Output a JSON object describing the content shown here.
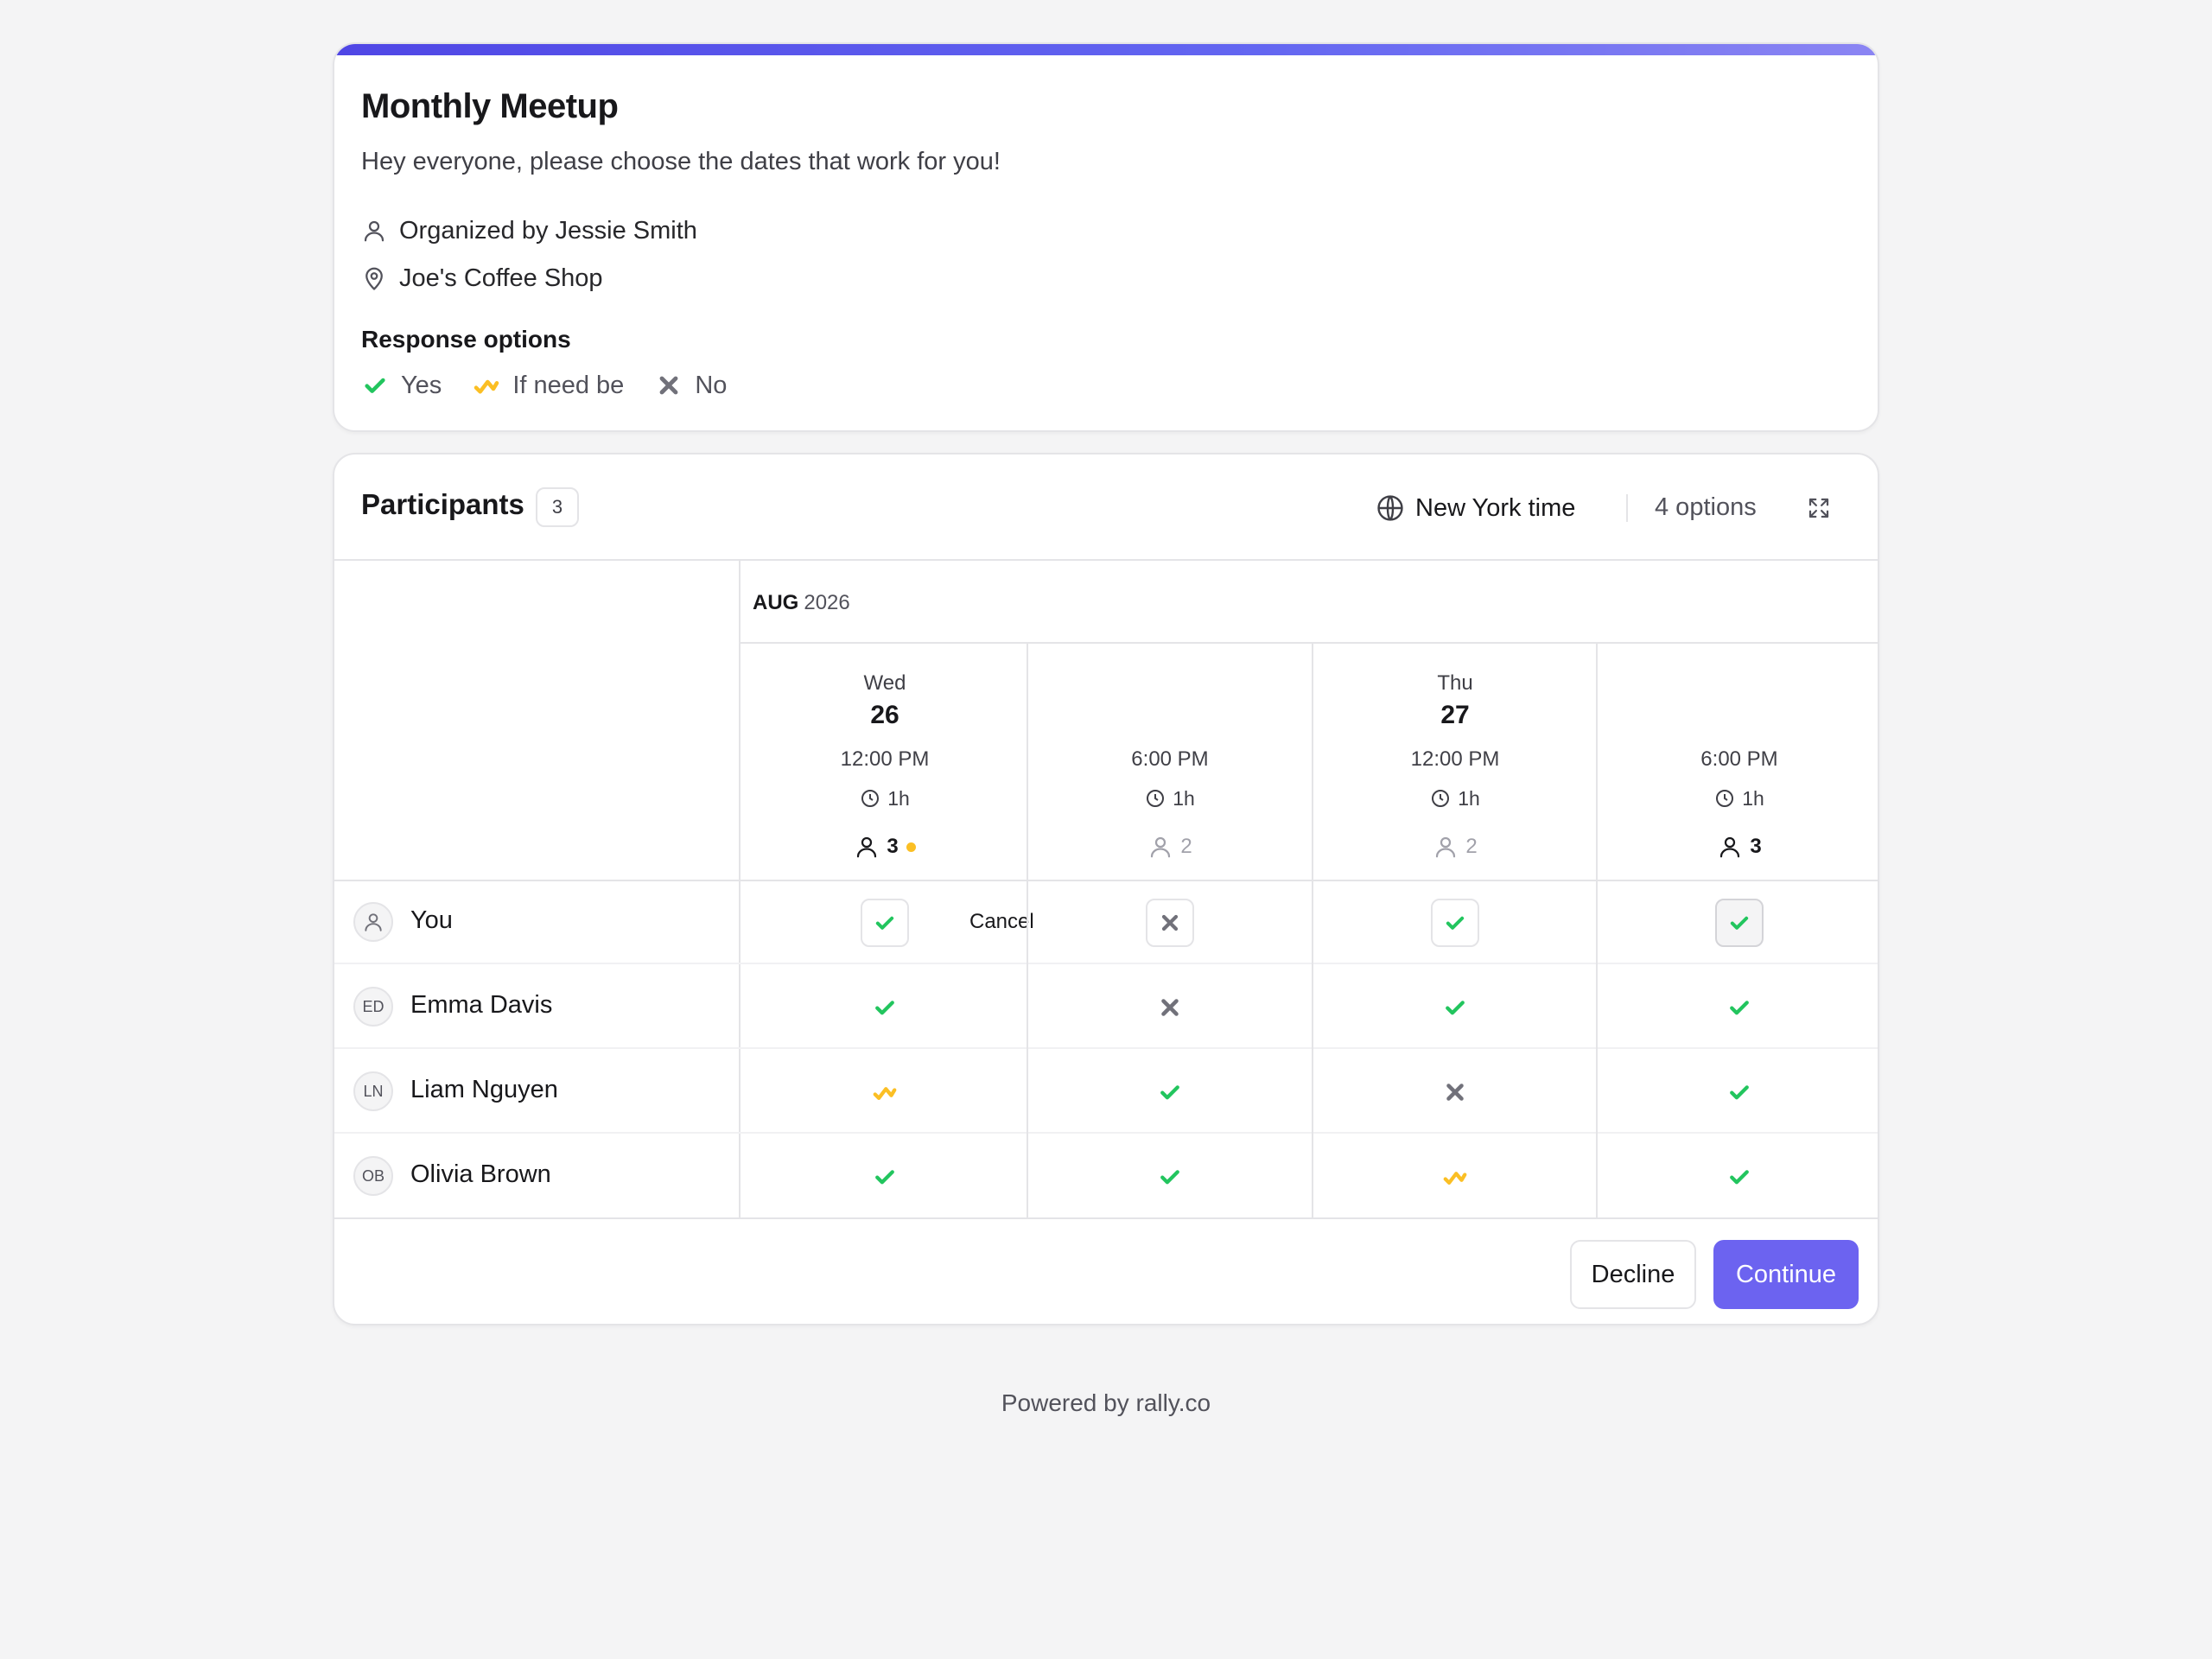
{
  "poll": {
    "title": "Monthly Meetup",
    "description": "Hey everyone, please choose the dates that work for you!",
    "organizer": "Organized by Jessie Smith",
    "location": "Joe's Coffee Shop",
    "response_options_title": "Response options",
    "response_options": [
      {
        "label": "Yes",
        "icon": "check-icon",
        "color": "#22c55e"
      },
      {
        "label": "If need be",
        "icon": "if-need-be-icon",
        "color": "#fbbf24"
      },
      {
        "label": "No",
        "icon": "x-icon",
        "color": "#71717a"
      }
    ]
  },
  "participants_panel": {
    "title": "Participants",
    "count": "3",
    "timezone": "New York time",
    "options_count": "4 options",
    "expand_icon": "expand-icon"
  },
  "grid": {
    "month": "AUG",
    "year": "2026",
    "days": [
      {
        "weekday": "Wed",
        "day": "26"
      },
      {
        "weekday": "Thu",
        "day": "27"
      }
    ],
    "slots": [
      {
        "time": "12:00 PM",
        "duration": "1h",
        "count": "3",
        "top": true,
        "pending": true
      },
      {
        "time": "6:00 PM",
        "duration": "1h",
        "count": "2",
        "top": false,
        "pending": false
      },
      {
        "time": "12:00 PM",
        "duration": "1h",
        "count": "2",
        "top": false,
        "pending": false
      },
      {
        "time": "6:00 PM",
        "duration": "1h",
        "count": "3",
        "top": true,
        "pending": false
      }
    ],
    "rows": [
      {
        "name": "You",
        "initials": "",
        "is_self": true,
        "cancel_label": "Cancel",
        "votes": [
          "yes",
          "no",
          "yes",
          "yes"
        ]
      },
      {
        "name": "Emma Davis",
        "initials": "ED",
        "is_self": false,
        "votes": [
          "yes",
          "no",
          "yes",
          "yes"
        ]
      },
      {
        "name": "Liam Nguyen",
        "initials": "LN",
        "is_self": false,
        "votes": [
          "ifneedbe",
          "yes",
          "no",
          "yes"
        ]
      },
      {
        "name": "Olivia Brown",
        "initials": "OB",
        "is_self": false,
        "votes": [
          "yes",
          "yes",
          "ifneedbe",
          "yes"
        ]
      }
    ]
  },
  "actions": {
    "decline_label": "Decline",
    "continue_label": "Continue"
  },
  "footer": {
    "powered_by": "Powered by rally.co"
  },
  "colors": {
    "accent": "#6c63f0",
    "yes": "#22c55e",
    "if_need_be": "#fbbf24",
    "no": "#71717a"
  }
}
